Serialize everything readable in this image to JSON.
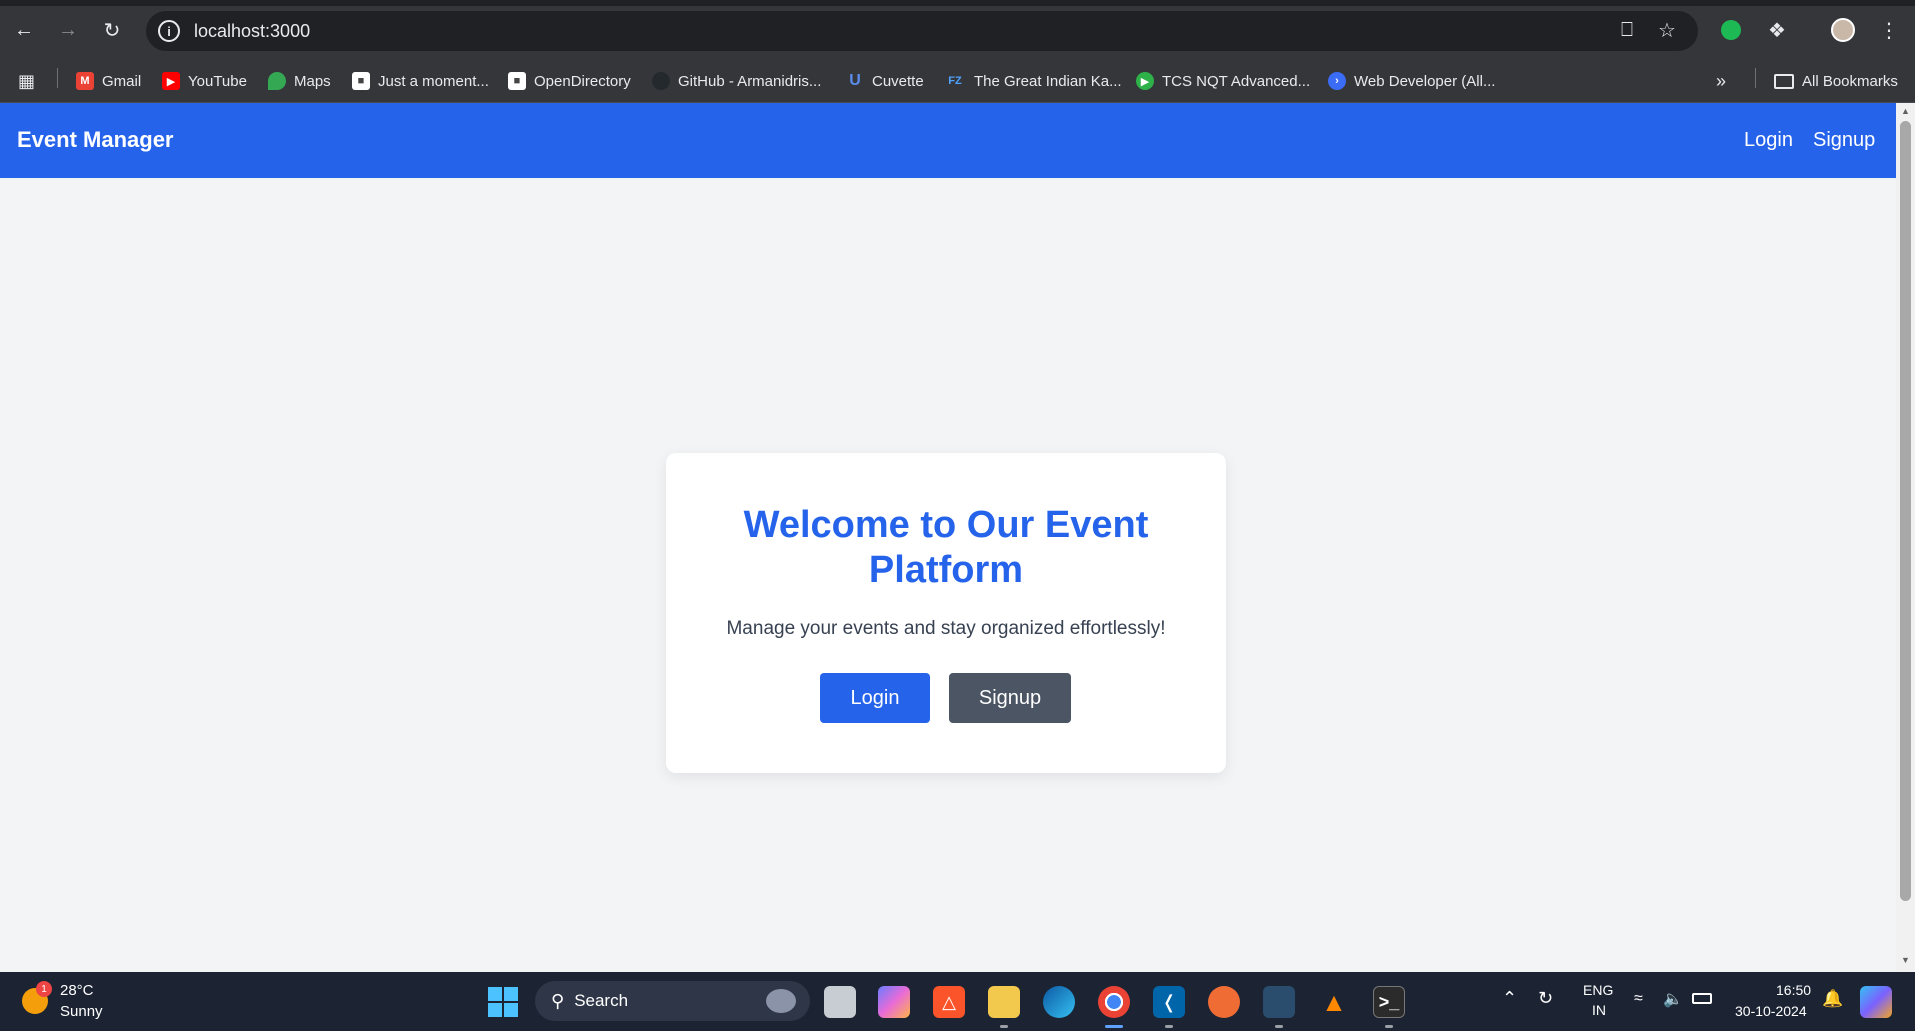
{
  "browser": {
    "url": "localhost:3000",
    "bookmarks": [
      {
        "label": "Gmail",
        "icon": "gmail-icon"
      },
      {
        "label": "YouTube",
        "icon": "youtube-icon"
      },
      {
        "label": "Maps",
        "icon": "maps-icon"
      },
      {
        "label": "Just a moment...",
        "icon": "page-icon"
      },
      {
        "label": "OpenDirectory",
        "icon": "page-icon"
      },
      {
        "label": "GitHub - Armanidris...",
        "icon": "github-icon"
      },
      {
        "label": "Cuvette",
        "icon": "cuvette-icon"
      },
      {
        "label": "The Great Indian Ka...",
        "icon": "fz-icon"
      },
      {
        "label": "TCS NQT Advanced...",
        "icon": "tcs-icon"
      },
      {
        "label": "Web Developer (All...",
        "icon": "web-dev-icon"
      }
    ],
    "all_bookmarks": "All Bookmarks"
  },
  "app": {
    "brand": "Event Manager",
    "nav": {
      "login": "Login",
      "signup": "Signup"
    },
    "card": {
      "title": "Welcome to Our Event Platform",
      "subtitle": "Manage your events and stay organized effortlessly!",
      "login_button": "Login",
      "signup_button": "Signup"
    },
    "colors": {
      "primary": "#2563eb",
      "secondary": "#4b5563",
      "background": "#f3f4f6"
    }
  },
  "taskbar": {
    "weather": {
      "temp": "28°C",
      "condition": "Sunny",
      "badge": "1"
    },
    "search": "Search",
    "language": {
      "line1": "ENG",
      "line2": "IN"
    },
    "time": "16:50",
    "date": "30-10-2024"
  }
}
